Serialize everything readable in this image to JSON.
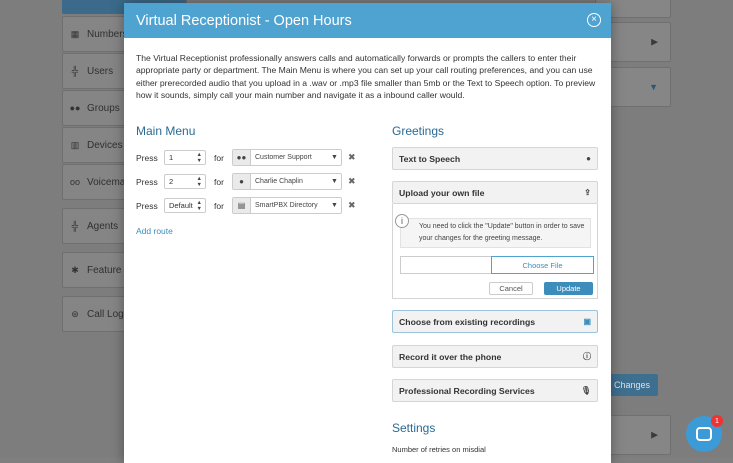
{
  "background": {
    "sidebar_items": [
      {
        "label": "Numbers",
        "icon": "grid-icon"
      },
      {
        "label": "Users",
        "icon": "org-icon"
      },
      {
        "label": "Groups",
        "icon": "users-icon"
      },
      {
        "label": "Devices",
        "icon": "devices-icon"
      },
      {
        "label": "Voicemai",
        "icon": "voicemail-icon"
      },
      {
        "label": "Agents",
        "icon": "org-icon"
      },
      {
        "label": "Feature Co",
        "icon": "asterisk-icon"
      },
      {
        "label": "Call Logs",
        "icon": "call-logs-icon"
      }
    ],
    "changes_button": "Changes"
  },
  "modal": {
    "title": "Virtual Receptionist - Open Hours",
    "description": "The Virtual Receptionist professionally answers calls and automatically forwards or prompts the callers to enter their appropriate party or department. The Main Menu is where you can set up your call routing preferences, and you can use either prerecorded audio that you upload in a .wav or .mp3 file smaller than 5mb or the Text to Speech option. To preview how it sounds, simply call your main number and navigate it as a inbound caller would.",
    "main_menu": {
      "heading": "Main Menu",
      "press_label": "Press",
      "for_label": "for",
      "routes": [
        {
          "key": "1",
          "target": "Customer Support",
          "icon": "users-icon"
        },
        {
          "key": "2",
          "target": "Charlie Chaplin",
          "icon": "user-icon"
        },
        {
          "key": "Default",
          "target": "SmartPBX Directory",
          "icon": "book-icon"
        }
      ],
      "add_route": "Add route"
    },
    "greetings": {
      "heading": "Greetings",
      "text_to_speech": "Text to Speech",
      "upload_own": "Upload your own file",
      "upload_note": "You need to click the \"Update\" button in order to save your changes for the greeting message.",
      "choose_file": "Choose File",
      "cancel": "Cancel",
      "update": "Update",
      "existing": "Choose from existing recordings",
      "record_phone": "Record it over the phone",
      "professional": "Professional Recording Services"
    },
    "settings": {
      "heading": "Settings",
      "retries_label": "Number of retries on misdial"
    }
  },
  "chat": {
    "badge": "1"
  }
}
